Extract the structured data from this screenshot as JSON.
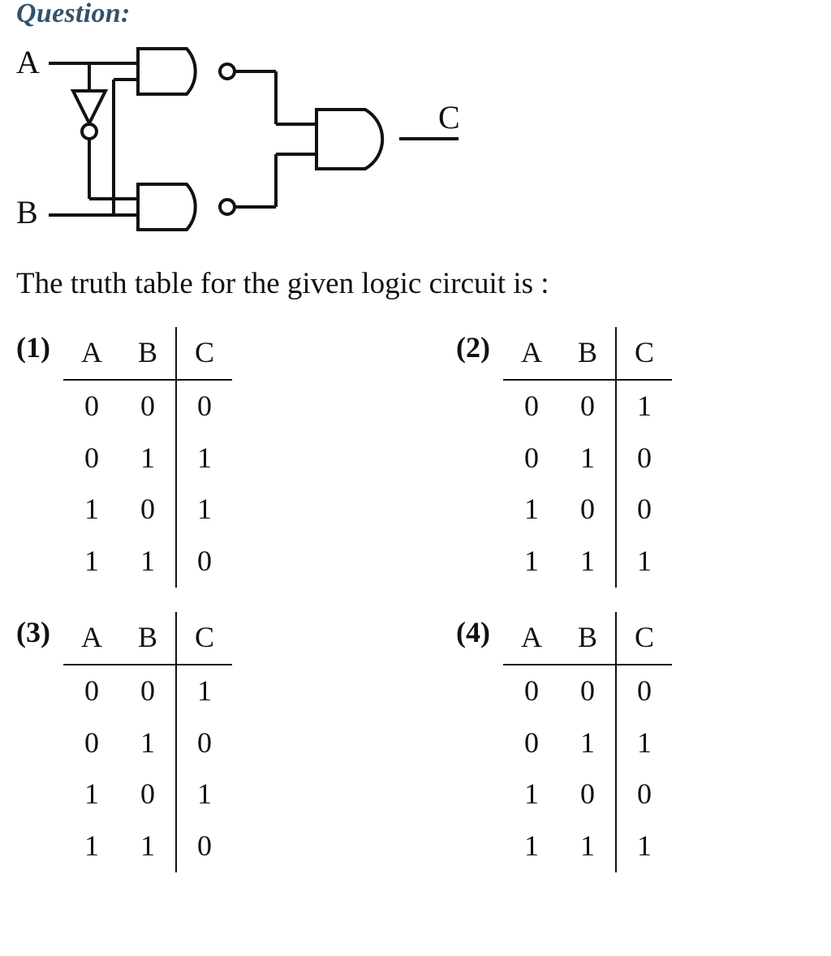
{
  "labels": {
    "question": "Question:",
    "A": "A",
    "B": "B",
    "C": "C",
    "prompt": "The truth table for the given logic circuit is :"
  },
  "option_numbers": [
    "(1)",
    "(2)",
    "(3)",
    "(4)"
  ],
  "tables": [
    {
      "headers": [
        "A",
        "B",
        "C"
      ],
      "rows": [
        [
          "0",
          "0",
          "0"
        ],
        [
          "0",
          "1",
          "1"
        ],
        [
          "1",
          "0",
          "1"
        ],
        [
          "1",
          "1",
          "0"
        ]
      ]
    },
    {
      "headers": [
        "A",
        "B",
        "C"
      ],
      "rows": [
        [
          "0",
          "0",
          "1"
        ],
        [
          "0",
          "1",
          "0"
        ],
        [
          "1",
          "0",
          "0"
        ],
        [
          "1",
          "1",
          "1"
        ]
      ]
    },
    {
      "headers": [
        "A",
        "B",
        "C"
      ],
      "rows": [
        [
          "0",
          "0",
          "1"
        ],
        [
          "0",
          "1",
          "0"
        ],
        [
          "1",
          "0",
          "1"
        ],
        [
          "1",
          "1",
          "0"
        ]
      ]
    },
    {
      "headers": [
        "A",
        "B",
        "C"
      ],
      "rows": [
        [
          "0",
          "0",
          "0"
        ],
        [
          "0",
          "1",
          "1"
        ],
        [
          "1",
          "0",
          "0"
        ],
        [
          "1",
          "1",
          "1"
        ]
      ]
    }
  ],
  "circuit": {
    "inputs": [
      "A",
      "B"
    ],
    "output": "C",
    "gates": [
      {
        "type": "NOT",
        "in": "A",
        "out": "notA"
      },
      {
        "type": "NAND",
        "in": [
          "A",
          "B"
        ],
        "out": "n1"
      },
      {
        "type": "NAND",
        "in": [
          "notA",
          "B"
        ],
        "out": "n2"
      },
      {
        "type": "AND",
        "in": [
          "n1",
          "n2"
        ],
        "out": "C"
      }
    ]
  }
}
